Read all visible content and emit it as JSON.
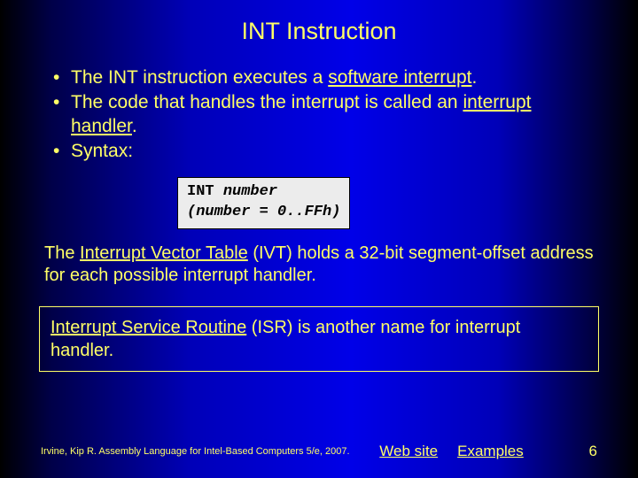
{
  "title": "INT Instruction",
  "bullets": {
    "b1_a": "The INT instruction executes a ",
    "b1_u": "software interrupt",
    "b1_b": ".",
    "b2_a": "The code that handles the interrupt is called an ",
    "b2_u": "interrupt handler",
    "b2_b": ".",
    "b3": "Syntax:"
  },
  "code": {
    "l1a": "INT ",
    "l1b": "number",
    "l2": "(number = 0..FFh)"
  },
  "para": {
    "a": "The ",
    "u": "Interrupt Vector Table",
    "b": " (IVT) holds a 32-bit segment-offset address for each possible interrupt handler."
  },
  "isr": {
    "u": "Interrupt Service Routine",
    "b": " (ISR) is another name for interrupt handler."
  },
  "footer": {
    "credit": "Irvine, Kip R. Assembly Language for Intel-Based Computers 5/e, 2007.",
    "link1": "Web site",
    "link2": "Examples",
    "page": "6"
  }
}
